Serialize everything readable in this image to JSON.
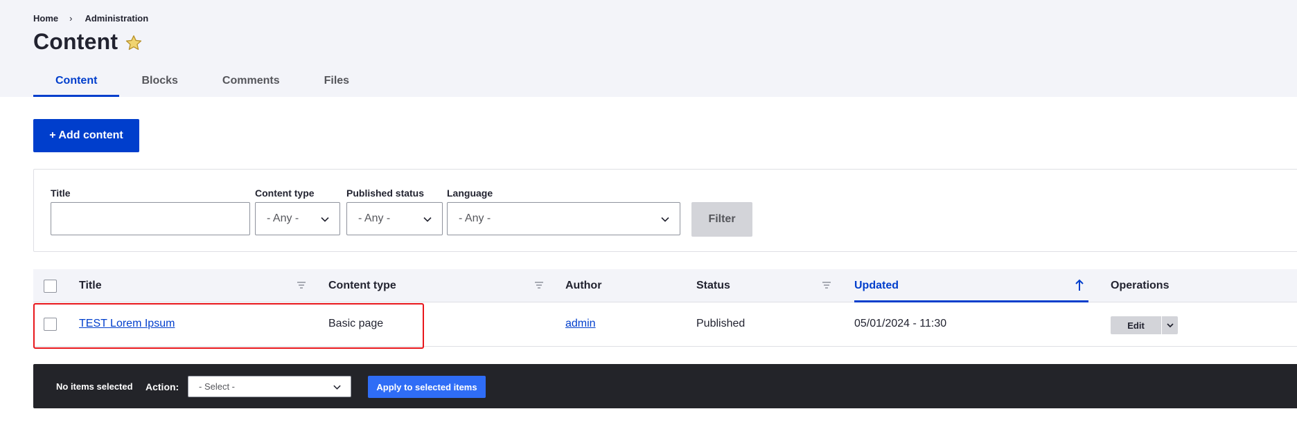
{
  "breadcrumb": {
    "items": [
      "Home",
      "Administration"
    ],
    "separator": "›"
  },
  "page": {
    "title": "Content",
    "favorite_icon": "star-icon"
  },
  "tabs": [
    {
      "label": "Content",
      "active": true
    },
    {
      "label": "Blocks",
      "active": false
    },
    {
      "label": "Comments",
      "active": false
    },
    {
      "label": "Files",
      "active": false
    }
  ],
  "actions": {
    "add_content_label": "+ Add content"
  },
  "filters": {
    "title": {
      "label": "Title",
      "value": ""
    },
    "content_type": {
      "label": "Content type",
      "selected": "- Any -"
    },
    "published_status": {
      "label": "Published status",
      "selected": "- Any -"
    },
    "language": {
      "label": "Language",
      "selected": "- Any -"
    },
    "submit_label": "Filter"
  },
  "table": {
    "columns": [
      "Title",
      "Content type",
      "Author",
      "Status",
      "Updated",
      "Operations"
    ],
    "sorted_column": "Updated",
    "sort_direction": "ascending",
    "rows": [
      {
        "title": "TEST Lorem Ipsum",
        "content_type": "Basic page",
        "author": "admin",
        "status": "Published",
        "updated": "05/01/2024 - 11:30",
        "operation": "Edit"
      }
    ]
  },
  "bulk": {
    "status": "No items selected",
    "action_label": "Action:",
    "action_selected": "- Select -",
    "apply_label": "Apply to selected items"
  },
  "colors": {
    "accent": "#003ecc",
    "header_bg": "#f3f4f9",
    "bulk_bar": "#232429",
    "apply_button": "#2f6df6",
    "highlight": "#e8161b",
    "star": "#e6b422"
  }
}
